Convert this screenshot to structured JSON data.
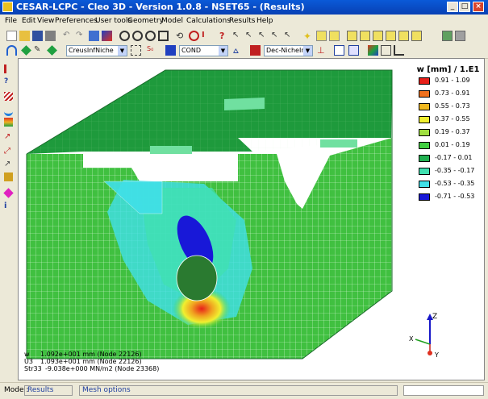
{
  "window": {
    "title": "CESAR-LCPC - Cleo 3D - Version 1.0.8 - NSET65 - (Results)",
    "min": "_",
    "max": "□",
    "close": "×"
  },
  "menu": [
    "File",
    "Edit",
    "View",
    "Preferences",
    "User tools",
    "Geometry",
    "Model",
    "Calculations",
    "Results",
    "Help"
  ],
  "toolbar2": {
    "group_combo": "CreusInfNiche",
    "cond_combo": "COND",
    "dec_combo": "Dec-NicheInf"
  },
  "legend": {
    "title": "w [mm] / 1.E1",
    "items": [
      {
        "range": "0.91 - 1.09",
        "color": "#e8201a"
      },
      {
        "range": "0.73 - 0.91",
        "color": "#f0701c"
      },
      {
        "range": "0.55 - 0.73",
        "color": "#f0b820"
      },
      {
        "range": "0.37 - 0.55",
        "color": "#f0f030"
      },
      {
        "range": "0.19 - 0.37",
        "color": "#a0e040"
      },
      {
        "range": "0.01 - 0.19",
        "color": "#40d040"
      },
      {
        "range": "-0.17 - 0.01",
        "color": "#20b050"
      },
      {
        "range": "-0.35 - -0.17",
        "color": "#40e0b0"
      },
      {
        "range": "-0.53 - -0.35",
        "color": "#40e0e8"
      },
      {
        "range": "-0.71 - -0.53",
        "color": "#1818d8"
      }
    ]
  },
  "readout": {
    "w_label": "w",
    "w_value": "1.092e+001 mm (Node 22126)",
    "u3_label": "U3",
    "u3_value": "1.093e+001 mm (Node 22126)",
    "str_label": "Str33",
    "str_value": "-9.038e+000 MN/m2 (Node 23368)"
  },
  "axes": {
    "z": "Z",
    "x": "X",
    "y": "Y"
  },
  "status": {
    "mode_label": "Mode :",
    "mode_value": "Results",
    "mesh": "Mesh options"
  }
}
